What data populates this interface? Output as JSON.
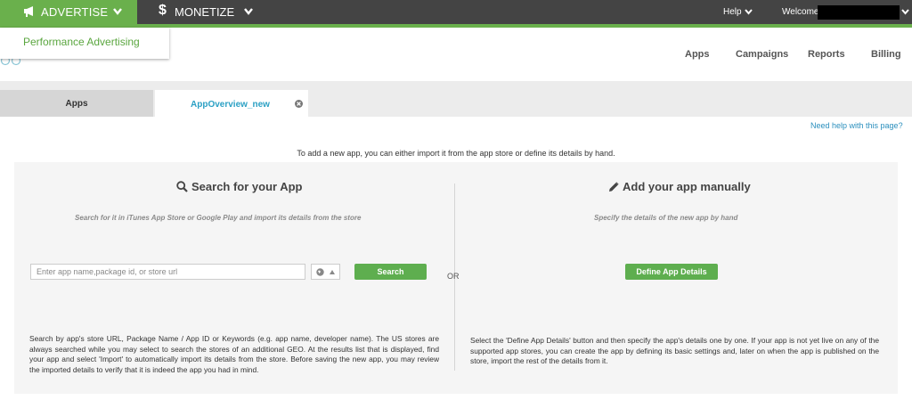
{
  "topbar": {
    "advertise_label": "ADVERTISE",
    "monetize_label": "MONETIZE",
    "monetize_icon": "$",
    "help_label": "Help",
    "welcome_label": "Welcome"
  },
  "dropdown": {
    "items": [
      "Performance Advertising"
    ]
  },
  "nav": {
    "apps": "Apps",
    "campaigns": "Campaigns",
    "reports": "Reports",
    "billing": "Billing"
  },
  "tabs": [
    {
      "label": "Apps"
    },
    {
      "label": "AppOverview_new"
    }
  ],
  "main": {
    "help_link": "Need help with this page?",
    "intro": "To add a new app, you can either import it from the app store or define its details by hand.",
    "or_label": "OR",
    "search_section": {
      "title": "Search for your App",
      "subtitle": "Search for it in iTunes App Store or Google Play and import its details from the store",
      "placeholder": "Enter app name,package id, or store url",
      "button": "Search",
      "description": "Search by app's store URL, Package Name / App ID or Keywords (e.g. app name, developer name). The US stores are always searched while you may select to search the stores of an additional GEO. At the results list that is displayed, find your app and select 'Import' to automatically import its details from the store. Before saving the new app, you may review the imported details to verify that it is indeed the app you had in mind."
    },
    "manual_section": {
      "title": "Add your app manually",
      "subtitle": "Specify the details of the new app by hand",
      "button": "Define App Details",
      "description": "Select the 'Define App Details' button and then specify the app's details one by one. If your app is not yet live on any of the supported app stores, you can create the app by defining its basic settings and, later on when the app is published on the store, import the rest of the details from it."
    }
  },
  "icons": {
    "advertise": "megaphone-icon",
    "search": "magnifier-icon",
    "manual": "pencil-icon",
    "geo": "globe-icon",
    "close": "close-circle-icon"
  },
  "colors": {
    "brand_green": "#6ab04c",
    "topbar": "#444444",
    "link_blue": "#2ba0c4"
  }
}
